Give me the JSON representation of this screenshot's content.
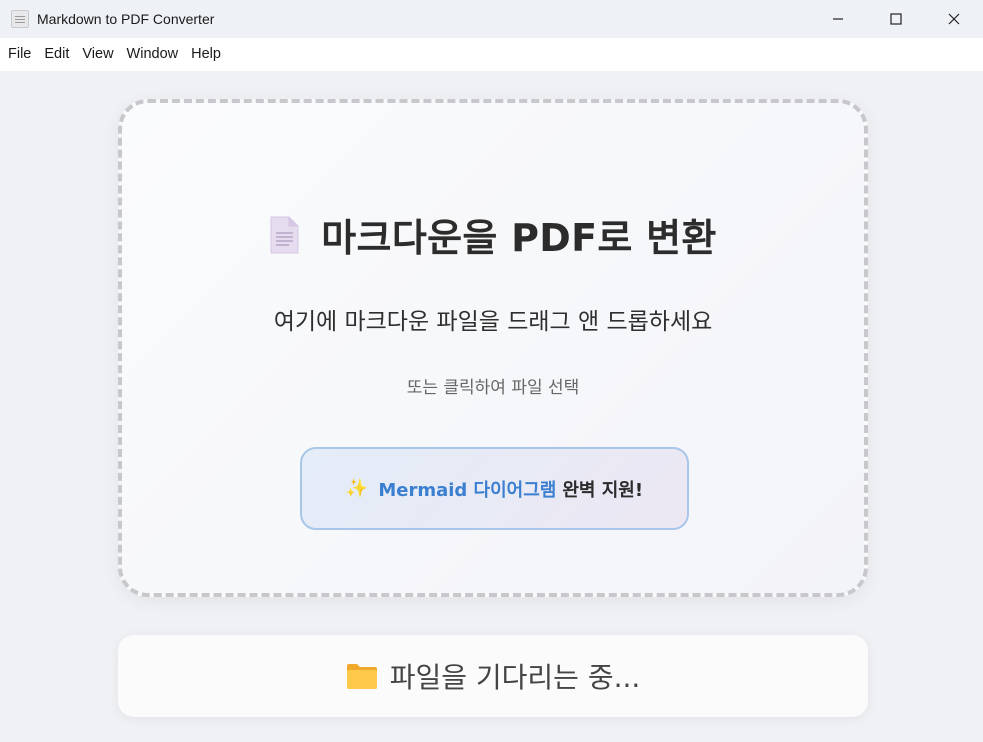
{
  "window": {
    "title": "Markdown to PDF Converter",
    "app_icon": "document-app-icon"
  },
  "controls": {
    "minimize": "—",
    "maximize": "☐",
    "close": "✕"
  },
  "menubar": {
    "items": [
      "File",
      "Edit",
      "View",
      "Window",
      "Help"
    ]
  },
  "dropzone": {
    "icon": "document-icon",
    "title": "마크다운을 PDF로 변환",
    "subtitle": "여기에 마크다운 파일을 드래그 앤 드롭하세요",
    "hint": "또는 클릭하여 파일 선택",
    "badge": {
      "icon": "sparkles-icon",
      "sparkle": "✨",
      "accent_text": "Mermaid 다이어그램",
      "text": "완벽 지원!"
    }
  },
  "status": {
    "icon": "folder-icon",
    "text": "파일을 기다리는 중..."
  },
  "colors": {
    "accent": "#3b7fd0",
    "badge_border": "#a7c6e8",
    "dashed_border": "#c8c8cc",
    "background": "#f0f1f5"
  }
}
